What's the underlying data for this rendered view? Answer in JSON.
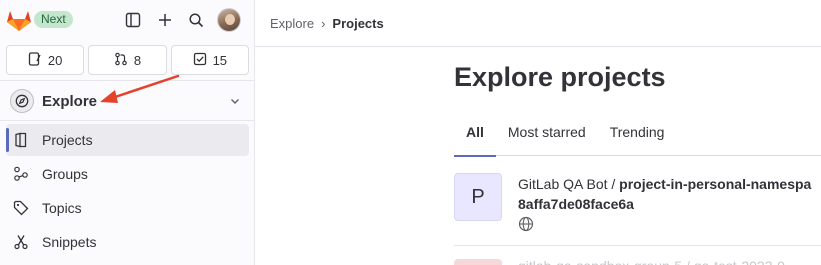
{
  "topbar": {
    "badge": "Next"
  },
  "counters": [
    {
      "icon": "issues-icon",
      "value": "20"
    },
    {
      "icon": "merge-requests-icon",
      "value": "8"
    },
    {
      "icon": "todo-icon",
      "value": "15"
    }
  ],
  "section": {
    "label": "Explore"
  },
  "nav": {
    "items": [
      {
        "label": "Projects",
        "icon": "project-icon",
        "active": true
      },
      {
        "label": "Groups",
        "icon": "groups-icon",
        "active": false
      },
      {
        "label": "Topics",
        "icon": "label-icon",
        "active": false
      },
      {
        "label": "Snippets",
        "icon": "snippet-icon",
        "active": false
      }
    ]
  },
  "breadcrumb": {
    "root": "Explore",
    "separator": "›",
    "current": "Projects"
  },
  "page": {
    "title": "Explore projects"
  },
  "tabs": [
    {
      "label": "All",
      "active": true
    },
    {
      "label": "Most starred",
      "active": false
    },
    {
      "label": "Trending",
      "active": false
    }
  ],
  "projects": [
    {
      "avatar_letter": "P",
      "namespace": "GitLab QA Bot / ",
      "name": "project-in-personal-namespa",
      "name_line2": "8affa7de08face6a",
      "visibility_icon": "earth-icon"
    },
    {
      "avatar_letter": "",
      "partial_text": "gitlab-qa-sandbox-group-5 / qa-test-2023-0"
    }
  ],
  "colors": {
    "accent": "#5a6ab8",
    "annotation_arrow": "#e2432a",
    "badge_bg": "#c3e6cd"
  }
}
